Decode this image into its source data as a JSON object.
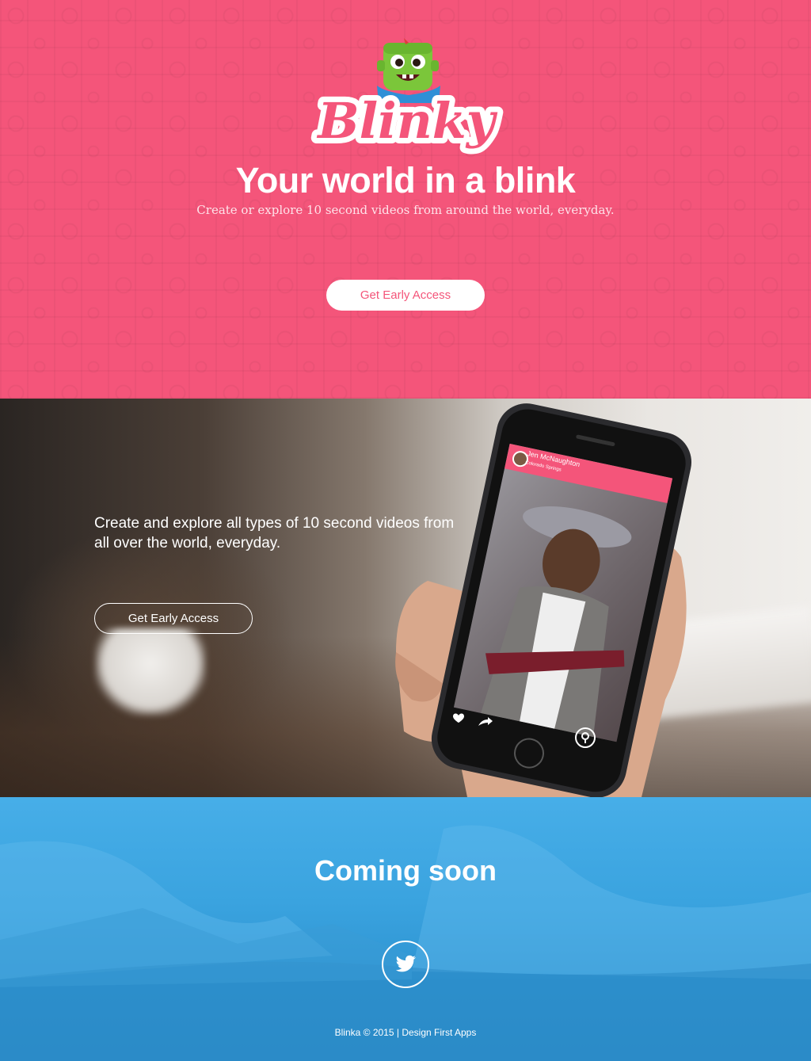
{
  "brand": {
    "logo_text": "Blinky",
    "pink": "#f4557a",
    "blue": "#3aa3df"
  },
  "hero": {
    "title": "Your world in a blink",
    "subtitle": "Create or explore 10 second videos from around the world, everyday.",
    "cta_label": "Get Early Access"
  },
  "showcase": {
    "caption": "Create and explore all types of 10 second videos from all over the world, everyday.",
    "cta_label": "Get Early Access",
    "phone_screen": {
      "user_name": "Jen McNaughton",
      "user_location": "Colorado Springs",
      "icons": [
        "heart-icon",
        "share-icon",
        "location-pin-icon"
      ]
    }
  },
  "coming_soon": {
    "title": "Coming soon",
    "social_icon": "twitter-icon"
  },
  "footer": {
    "text": "Blinka © 2015 | Design First Apps"
  }
}
